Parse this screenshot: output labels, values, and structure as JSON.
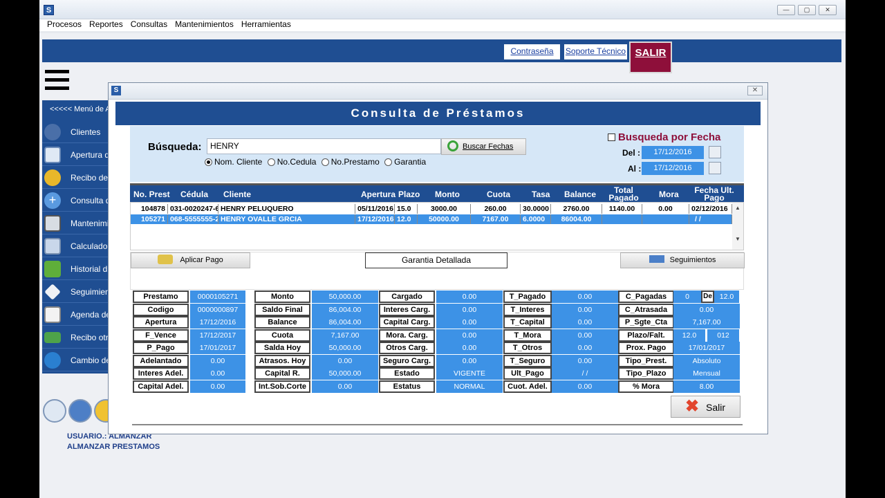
{
  "window": {
    "icon": "S",
    "minimize": "—",
    "maximize": "▢",
    "close": "✕"
  },
  "menu": [
    "Procesos",
    "Reportes",
    "Consultas",
    "Mantenimientos",
    "Herramientas"
  ],
  "top_links": {
    "password": "Contraseña",
    "support": "Soporte Técnico",
    "exit": "SALIR"
  },
  "sidebar": {
    "header": "<<<<< Menú de A",
    "items": [
      {
        "label": "Clientes",
        "icon": "user-icon"
      },
      {
        "label": "Apertura d",
        "icon": "computer-icon"
      },
      {
        "label": "Recibo de",
        "icon": "coins-icon"
      },
      {
        "label": "Consulta d",
        "icon": "plus-icon"
      },
      {
        "label": "Mantenimi",
        "icon": "printer-icon"
      },
      {
        "label": "Calculado",
        "icon": "calculator-icon"
      },
      {
        "label": "Historial d",
        "icon": "chart-icon"
      },
      {
        "label": "Seguimien",
        "icon": "tag-icon"
      },
      {
        "label": "Agenda de",
        "icon": "checklist-icon"
      },
      {
        "label": "Recibo otr",
        "icon": "money-icon"
      },
      {
        "label": "Cambio de",
        "icon": "globe-icon"
      }
    ]
  },
  "user": {
    "line1": "USUARIO.: ALMANZAR",
    "line2": "ALMANZAR PRESTAMOS"
  },
  "dialog": {
    "title": "Consulta de Préstamos",
    "search_label": "Búsqueda:",
    "search_value": "HENRY",
    "search_button": "Buscar Fechas",
    "radios": [
      "Nom. Cliente",
      "No.Cedula",
      "No.Prestamo",
      "Garantia"
    ],
    "date_check": "Busqueda por Fecha",
    "del_label": "Del :",
    "del_value": "17/12/2016",
    "al_label": "Al :",
    "al_value": "17/12/2016",
    "columns": [
      "No. Prest",
      "Cédula",
      "Cliente",
      "Apertura",
      "Plazo",
      "Monto",
      "Cuota",
      "Tasa",
      "Balance",
      "Total Pagado",
      "Mora",
      "Fecha Ult. Pago"
    ],
    "rows": [
      [
        "104878",
        "031-0020247-6",
        "HENRY PELUQUERO",
        "05/11/2016",
        "15.0",
        "3000.00",
        "260.00",
        "30.0000",
        "2760.00",
        "1140.00",
        "0.00",
        "02/12/2016"
      ],
      [
        "105271",
        "068-5555555-2",
        "HENRY OVALLE GRCIA",
        "17/12/2016",
        "12.0",
        "50000.00",
        "7167.00",
        "6.0000",
        "86004.00",
        "",
        "",
        "/ /"
      ]
    ],
    "action_pay": "Aplicar Pago",
    "action_garantia": "Garantia Detallada",
    "action_seg": "Seguimientos",
    "details": [
      [
        [
          "Prestamo",
          "0000105271"
        ],
        [
          "Monto",
          "50,000.00"
        ],
        [
          "Cargado",
          "0.00"
        ],
        [
          "T_Pagado",
          "0.00"
        ],
        [
          "C_Pagadas",
          ""
        ]
      ],
      [
        [
          "Codigo",
          "0000000897"
        ],
        [
          "Saldo Final",
          "86,004.00"
        ],
        [
          "Interes Carg.",
          "0.00"
        ],
        [
          "T_Interes",
          "0.00"
        ],
        [
          "C_Atrasada",
          "0.00"
        ]
      ],
      [
        [
          "Apertura",
          "17/12/2016"
        ],
        [
          "Balance",
          "86,004.00"
        ],
        [
          "Capital Carg.",
          "0.00"
        ],
        [
          "T_Capital",
          "0.00"
        ],
        [
          "P_Sgte_Cta",
          "7,167.00"
        ]
      ],
      [
        [
          "F_Vence",
          "17/12/2017"
        ],
        [
          "Cuota",
          "7,167.00"
        ],
        [
          "Mora. Carg.",
          "0.00"
        ],
        [
          "T_Mora",
          "0.00"
        ],
        [
          "Plazo/Falt.",
          ""
        ]
      ],
      [
        [
          "P_Pago",
          "17/01/2017"
        ],
        [
          "Salda Hoy",
          "50,000.00"
        ],
        [
          "Otros Carg.",
          "0.00"
        ],
        [
          "T_Otros",
          "0.00"
        ],
        [
          "Prox. Pago",
          "17/01/2017"
        ]
      ],
      [
        [
          "Adelantado",
          "0.00"
        ],
        [
          "Atrasos. Hoy",
          "0.00"
        ],
        [
          "Seguro Carg.",
          "0.00"
        ],
        [
          "T_Seguro",
          "0.00"
        ],
        [
          "Tipo_Prest.",
          "Absoluto"
        ]
      ],
      [
        [
          "Interes Adel.",
          "0.00"
        ],
        [
          "Capital R.",
          "50,000.00"
        ],
        [
          "Estado",
          "VIGENTE"
        ],
        [
          "Ult_Pago",
          "/ /"
        ],
        [
          "Tipo_Plazo",
          "Mensual"
        ]
      ],
      [
        [
          "Capital Adel.",
          "0.00"
        ],
        [
          "Int.Sob.Corte",
          "0.00"
        ],
        [
          "Estatus",
          "NORMAL"
        ],
        [
          "Cuot. Adel.",
          "0.00"
        ],
        [
          "% Mora",
          "8.00"
        ]
      ]
    ],
    "c_pagadas": {
      "a": "0",
      "de": "De",
      "b": "12.0"
    },
    "plazo_falt": {
      "a": "12.0",
      "b": "012"
    },
    "exit_button": "Salir"
  }
}
